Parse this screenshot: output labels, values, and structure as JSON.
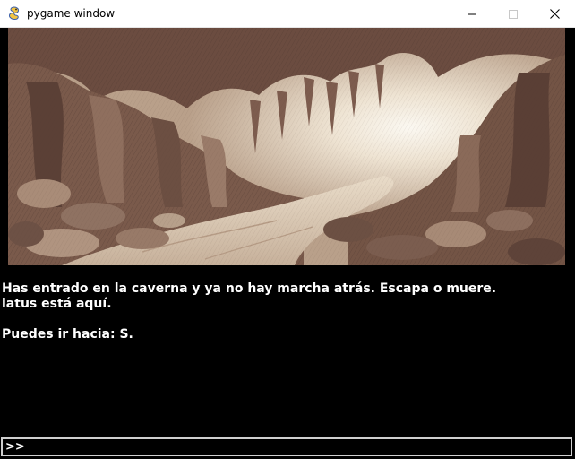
{
  "window": {
    "title": "pygame window",
    "icon": "pygame-snake-icon",
    "controls": [
      "minimize-icon",
      "maximize-icon",
      "close-icon"
    ]
  },
  "scene": {
    "subject": "cave-corridor-illustration",
    "palette": {
      "light": "#efe6d8",
      "mid": "#b59c86",
      "dark": "#5a3f35",
      "shadow": "#3d2a25"
    }
  },
  "narrative": {
    "line1": "Has entrado en la caverna y ya no hay marcha atrás. Escapa o muere.",
    "line2": "latus está aquí.",
    "line3": "Puedes ir hacia: S."
  },
  "command": {
    "prompt": ">>",
    "value": ""
  },
  "colors": {
    "background": "#000000",
    "text": "#ffffff",
    "input_border": "#cfcfcf"
  }
}
